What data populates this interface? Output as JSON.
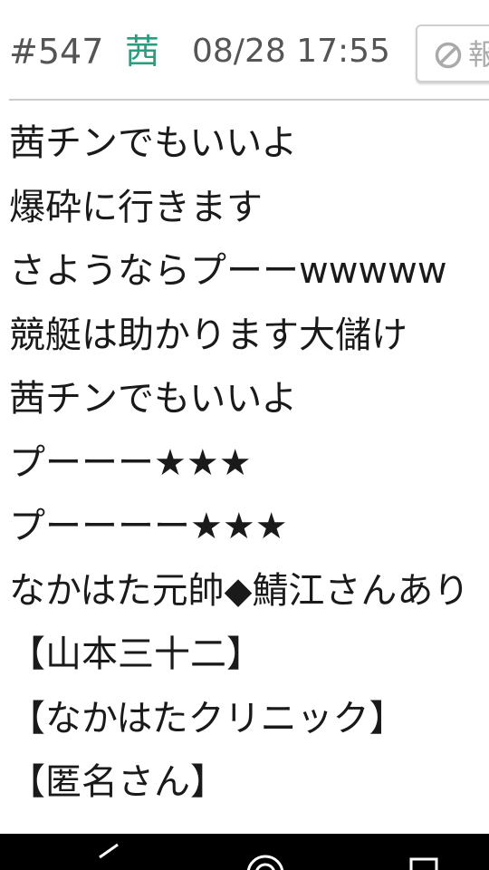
{
  "header": {
    "post_number": "#547",
    "author_name": "茜",
    "author_color": "#2a9d7f",
    "date": "08/28 17:55",
    "report_button": {
      "label": "報",
      "icon": "prohibit-icon"
    }
  },
  "post": {
    "lines": [
      "茜チンでもいいよ",
      "爆砕に行きます",
      "さようならプーーwwwww",
      "競艇は助かります大儲け",
      "茜チンでもいいよ",
      "プーーー★★★",
      "プーーーー★★★",
      "なかはた元帥◆鯖江さんあり",
      "【山本三十二】",
      "【なかはたクリニック】",
      "【匿名さん】"
    ]
  },
  "nav_bar": {
    "icons": [
      "back-icon",
      "home-icon",
      "recent-apps-icon"
    ]
  }
}
